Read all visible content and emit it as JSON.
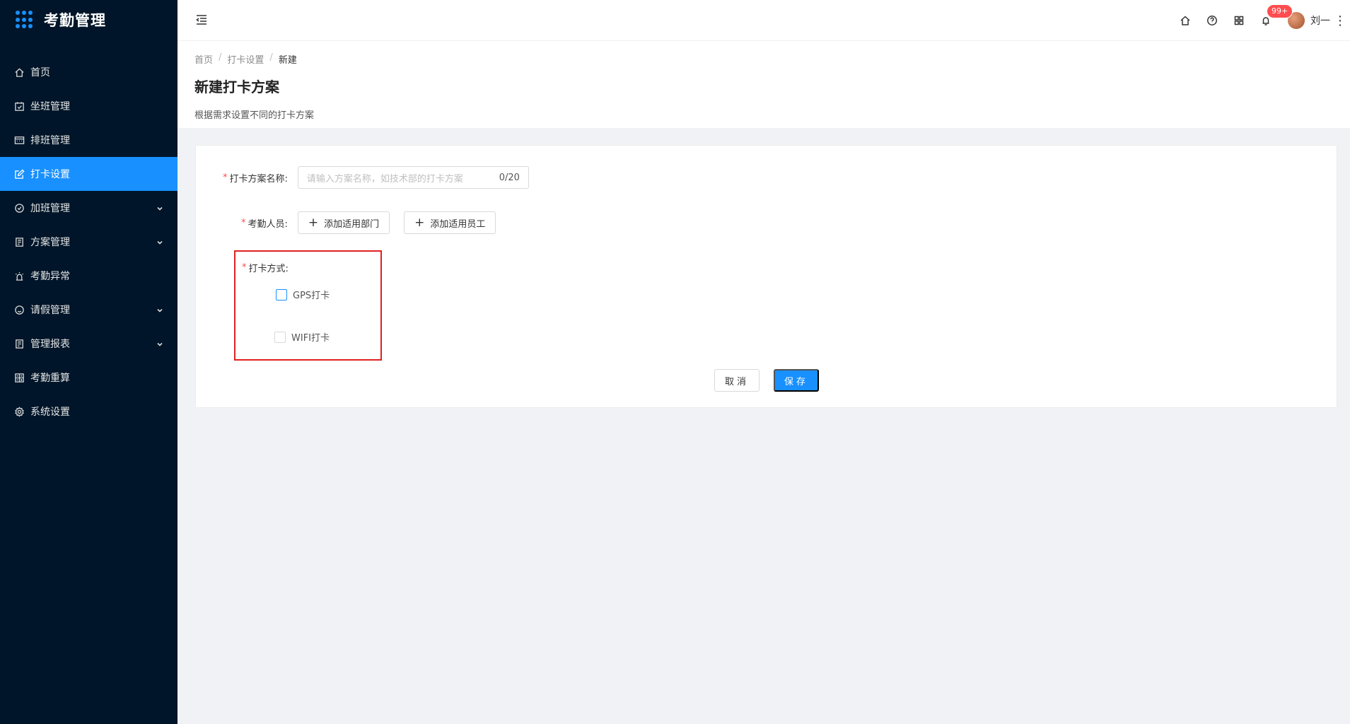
{
  "app": {
    "title": "考勤管理",
    "brand_color": "#1890ff",
    "sidebar_bg": "#001529"
  },
  "sidebar": {
    "items": [
      {
        "label": "首页",
        "icon": "home-icon",
        "active": false,
        "expandable": false
      },
      {
        "label": "坐班管理",
        "icon": "calendar-check-icon",
        "active": false,
        "expandable": false
      },
      {
        "label": "排班管理",
        "icon": "schedule-icon",
        "active": false,
        "expandable": false
      },
      {
        "label": "打卡设置",
        "icon": "edit-icon",
        "active": true,
        "expandable": false
      },
      {
        "label": "加班管理",
        "icon": "clock-icon",
        "active": false,
        "expandable": true
      },
      {
        "label": "方案管理",
        "icon": "document-icon",
        "active": false,
        "expandable": true
      },
      {
        "label": "考勤异常",
        "icon": "alarm-icon",
        "active": false,
        "expandable": false
      },
      {
        "label": "请假管理",
        "icon": "smile-icon",
        "active": false,
        "expandable": true
      },
      {
        "label": "管理报表",
        "icon": "report-icon",
        "active": false,
        "expandable": true
      },
      {
        "label": "考勤重算",
        "icon": "calculator-icon",
        "active": false,
        "expandable": false
      },
      {
        "label": "系统设置",
        "icon": "gear-icon",
        "active": false,
        "expandable": false
      }
    ]
  },
  "header": {
    "notification_badge": "99+",
    "user_name": "刘一",
    "badge_color": "#ff4d4f"
  },
  "breadcrumb": {
    "items": [
      "首页",
      "打卡设置"
    ],
    "current": "新建",
    "separator": "/"
  },
  "page": {
    "title": "新建打卡方案",
    "description": "根据需求设置不同的打卡方案"
  },
  "form": {
    "name_field": {
      "label": "打卡方案名称:",
      "placeholder": "请输入方案名称，如技术部的打卡方案",
      "value": "",
      "counter": "0/20"
    },
    "members_field": {
      "label": "考勤人员:",
      "add_dept_label": "添加适用部门",
      "add_staff_label": "添加适用员工"
    },
    "method_field": {
      "label": "打卡方式:",
      "options": [
        {
          "label": "GPS打卡",
          "checked": false
        },
        {
          "label": "WIFI打卡",
          "checked": false
        }
      ]
    },
    "cancel_label": "取消",
    "save_label": "保存"
  }
}
